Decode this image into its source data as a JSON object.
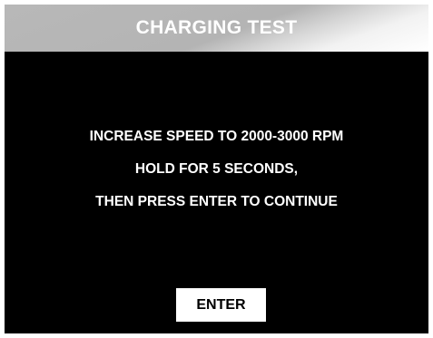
{
  "header": {
    "title": "CHARGING TEST"
  },
  "message": {
    "lines": [
      "INCREASE SPEED TO 2000-3000 RPM",
      "HOLD FOR 5 SECONDS,",
      "THEN PRESS ENTER TO CONTINUE"
    ]
  },
  "actions": {
    "enter_label": "ENTER"
  }
}
